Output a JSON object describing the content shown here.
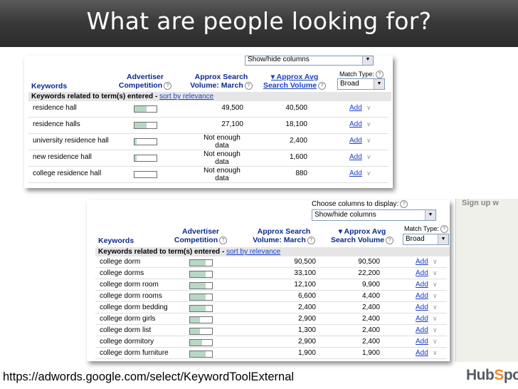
{
  "slide": {
    "title": "What are people looking for?",
    "url": "https://adwords.google.com/select/KeywordToolExternal",
    "logo": "HubSpot"
  },
  "screenshot1": {
    "columns_dropdown": "Show/hide columns",
    "headers": {
      "keywords": "Keywords",
      "advertiser": "Advertiser",
      "competition": "Competition",
      "approx_search": "Approx Search",
      "volume_march": "Volume: March",
      "approx_avg": "▾ Approx Avg",
      "search_volume": "Search Volume",
      "match_type": "Match Type:",
      "match_value": "Broad"
    },
    "section_label": "Keywords related to term(s) entered",
    "section_link": "sort by relevance",
    "rows": [
      {
        "keyword": "residence hall",
        "competition": 0.55,
        "march": "49,500",
        "avg": "40,500",
        "add": "Add"
      },
      {
        "keyword": "residence halls",
        "competition": 0.55,
        "march": "27,100",
        "avg": "18,100",
        "add": "Add"
      },
      {
        "keyword": "university residence hall",
        "competition": 0.1,
        "march_line1": "Not enough",
        "march_line2": "data",
        "avg": "2,400",
        "add": "Add"
      },
      {
        "keyword": "new residence hall",
        "competition": 0.1,
        "march_line1": "Not enough",
        "march_line2": "data",
        "avg": "1,600",
        "add": "Add"
      },
      {
        "keyword": "college residence hall",
        "competition": 0.0,
        "march_line1": "Not enough",
        "march_line2": "data",
        "avg": "880",
        "add": "Add"
      }
    ]
  },
  "screenshot2": {
    "choose_label": "Choose columns to display:",
    "columns_dropdown": "Show/hide columns",
    "signup": "Sign up w",
    "headers": {
      "keywords": "Keywords",
      "advertiser": "Advertiser",
      "competition": "Competition",
      "approx_search": "Approx Search",
      "volume_march": "Volume: March",
      "approx_avg": "▾ Approx Avg",
      "search_volume": "Search Volume",
      "match_type": "Match Type:",
      "match_value": "Broad"
    },
    "section_label": "Keywords related to term(s) entered",
    "section_link": "sort by relevance",
    "rows": [
      {
        "keyword": "college dorm",
        "competition": 0.7,
        "march": "90,500",
        "avg": "90,500",
        "add": "Add"
      },
      {
        "keyword": "college dorms",
        "competition": 0.7,
        "march": "33,100",
        "avg": "22,200",
        "add": "Add"
      },
      {
        "keyword": "college dorm room",
        "competition": 0.7,
        "march": "12,100",
        "avg": "9,900",
        "add": "Add"
      },
      {
        "keyword": "college dorm rooms",
        "competition": 0.7,
        "march": "6,600",
        "avg": "4,400",
        "add": "Add"
      },
      {
        "keyword": "college dorm bedding",
        "competition": 0.7,
        "march": "2,400",
        "avg": "2,400",
        "add": "Add"
      },
      {
        "keyword": "college dorm girls",
        "competition": 0.45,
        "march": "2,900",
        "avg": "2,400",
        "add": "Add"
      },
      {
        "keyword": "college dorm list",
        "competition": 0.45,
        "march": "1,300",
        "avg": "2,400",
        "add": "Add"
      },
      {
        "keyword": "college dormitory",
        "competition": 0.55,
        "march": "2,900",
        "avg": "2,400",
        "add": "Add"
      },
      {
        "keyword": "college dorm furniture",
        "competition": 0.7,
        "march": "1,900",
        "avg": "1,900",
        "add": "Add"
      }
    ]
  }
}
